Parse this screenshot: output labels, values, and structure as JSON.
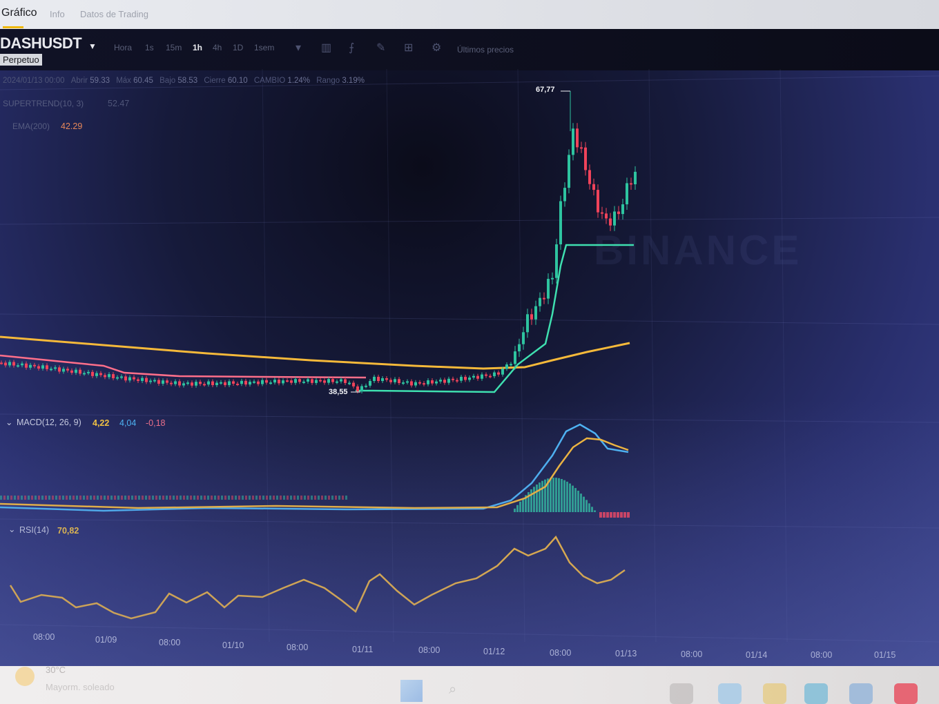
{
  "tabs": [
    {
      "label": "Gráfico"
    },
    {
      "label": "Info"
    },
    {
      "label": "Datos de Trading"
    }
  ],
  "symbol": {
    "name": "DASHUSDT",
    "type": "Perpetuo"
  },
  "timeframes": [
    "Hora",
    "1s",
    "15m",
    "1h",
    "4h",
    "1D",
    "1sem"
  ],
  "active_timeframe": "1h",
  "toolbar": {
    "more_label": "Últimos precios",
    "icons": [
      "candle-type-icon",
      "indicator-icon",
      "drawing-icon",
      "layout-icon",
      "settings-icon"
    ]
  },
  "ohlc": {
    "date": "2024/01/13 00:00",
    "open_label": "Abrir",
    "open": "59.33",
    "high_label": "Máx",
    "high": "60.45",
    "low_label": "Bajo",
    "low": "58.53",
    "close_label": "Cierre",
    "close": "60.10",
    "change_label": "CAMBIO",
    "change": "1.24%",
    "range_label": "Rango",
    "range": "3.19%"
  },
  "indicators": {
    "line1_label": "SUPERTREND(10, 3)",
    "line1_value": "52.47",
    "line2_label": "EMA(200)",
    "line2_value": "42.29"
  },
  "price_markers": {
    "high": "67,77",
    "low": "38,55"
  },
  "watermark": "BINANCE",
  "macd": {
    "label": "MACD(12, 26, 9)",
    "macd": "4,22",
    "signal": "4,04",
    "hist": "-0,18"
  },
  "rsi": {
    "label": "RSI(14)",
    "value": "70,82"
  },
  "x_axis": [
    "08:00",
    "01/09",
    "08:00",
    "01/10",
    "08:00",
    "01/11",
    "08:00",
    "01/12",
    "08:00",
    "01/13",
    "08:00",
    "01/14",
    "08:00",
    "01/15"
  ],
  "taskbar": {
    "weather_temp": "30°C",
    "weather_desc": "Mayorm. soleado"
  },
  "colors": {
    "up": "#2ec4a0",
    "down": "#f0435a",
    "ema": "#f5b93a",
    "supertrend_up": "#3fe0b0",
    "supertrend_down": "#ff6f8a",
    "macd_line": "#4db5f5",
    "signal_line": "#f5b93a",
    "rsi_line": "#f5b93a"
  }
}
